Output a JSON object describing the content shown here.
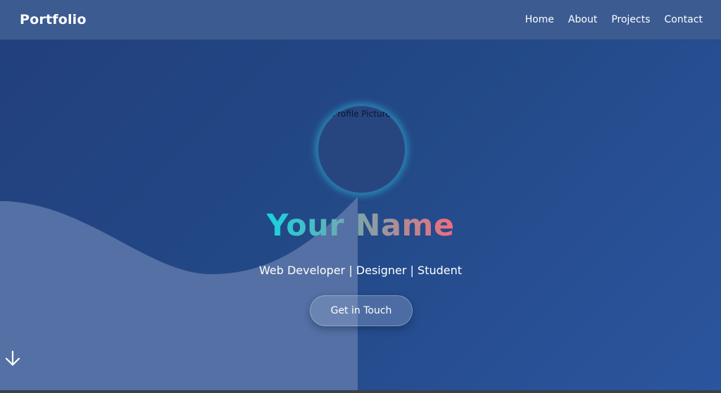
{
  "navbar": {
    "brand": "Portfolio",
    "links": [
      "Home",
      "About",
      "Projects",
      "Contact"
    ]
  },
  "hero": {
    "profile_alt": "Profile Picture",
    "name": "Your Name",
    "tagline": "Web Developer | Designer | Student",
    "cta_label": "Get in Touch"
  },
  "icons": {
    "scroll": "arrow-down-icon"
  },
  "colors": {
    "background": "#234987",
    "navbar": "#3b5b91",
    "wave": "#5470a4",
    "name_gradient_start": "#16d3de",
    "name_gradient_end": "#f46b7c",
    "glow": "#2dc8e6"
  }
}
